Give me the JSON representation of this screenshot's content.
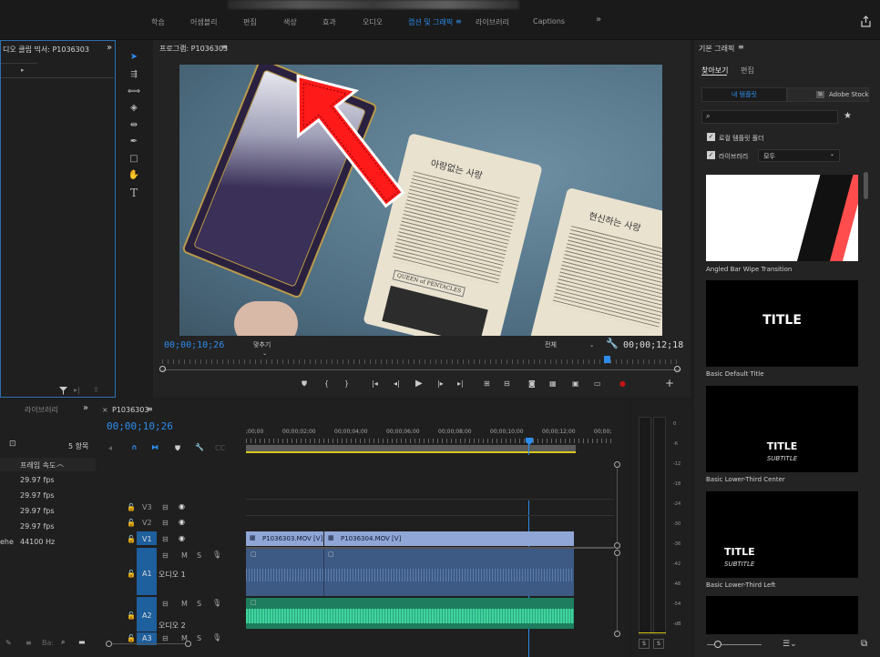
{
  "topbar": {
    "workspaces": [
      {
        "label": "학습",
        "active": false
      },
      {
        "label": "어셈블리",
        "active": false
      },
      {
        "label": "편집",
        "active": false
      },
      {
        "label": "색상",
        "active": false
      },
      {
        "label": "효과",
        "active": false
      },
      {
        "label": "오디오",
        "active": false
      },
      {
        "label": "캡션 및 그래픽",
        "active": true
      },
      {
        "label": "라이브러리",
        "active": false
      },
      {
        "label": "Captions",
        "active": false
      }
    ],
    "more": "»",
    "menu_icon": "≡"
  },
  "source_panel": {
    "title": "디오 클립 믹서: P1036303",
    "more": "»"
  },
  "program": {
    "title": "프로그램: P1036303",
    "menu": "≡",
    "timecode": "00;00;10;26",
    "fit": "맞추기",
    "quality": "전체",
    "duration": "00;00;12;18",
    "video": {
      "card1_title": "아랑없는 사랑",
      "card1_sub": "QUEEN of PENTACLES",
      "card2_title": "현신하는 사랑"
    }
  },
  "project_panel": {
    "tab": "라이브러리",
    "more": "»",
    "count": "5 항목",
    "col_framerate": "프레임 속도",
    "rows": [
      "29.97 fps",
      "29.97 fps",
      "29.97 fps",
      "29.97 fps",
      "44100 Hz"
    ],
    "row_prefix": "ehe"
  },
  "timeline": {
    "close": "×",
    "sequence": "P1036303",
    "menu": "≡",
    "timecode": "00;00;10;26",
    "ruler": [
      ";00;00",
      "00;00;02;00",
      "00;00;04;00",
      "00;00;06;00",
      "00;00;08;00",
      "00;00;10;00",
      "00;00;12;00",
      "00;00;"
    ],
    "tracks": {
      "v3": "V3",
      "v2": "V2",
      "v1": "V1",
      "a1": "A1",
      "a2": "A2",
      "a3": "A3",
      "a1_name": "오디오 1",
      "a2_name": "오디오 2",
      "mute": "M",
      "solo": "S"
    },
    "clips": {
      "v1a": "P1036303.MOV [V]",
      "v1b": "P1036304.MOV [V]"
    }
  },
  "meter": {
    "scale": [
      "0",
      "-6",
      "-12",
      "-18",
      "-24",
      "-30",
      "-36",
      "-42",
      "-48",
      "-54",
      "-dB"
    ],
    "solo1": "S",
    "solo2": "S"
  },
  "essential_graphics": {
    "title": "기본 그래픽",
    "menu": "≡",
    "tab_browse": "찾아보기",
    "tab_edit": "편집",
    "btn_my_templates": "내 템플릿",
    "btn_adobe_stock": "Adobe Stock",
    "stock_badge": "St",
    "search_placeholder": "",
    "local_folder": "로컬 템플릿 폴더",
    "libraries": "라이브러리",
    "libraries_select": "모두",
    "templates": [
      {
        "label": "Angled Bar Wipe Transition",
        "title": "",
        "subtitle": ""
      },
      {
        "label": "Basic Default Title",
        "title": "TITLE",
        "subtitle": ""
      },
      {
        "label": "Basic Lower-Third Center",
        "title": "TITLE",
        "subtitle": "SUBTITLE"
      },
      {
        "label": "Basic Lower-Third Left",
        "title": "TITLE",
        "subtitle": "SUBTITLE"
      }
    ]
  },
  "colors": {
    "accent": "#2d8ceb",
    "clip_video": "#8fa6d6",
    "clip_audio": "#2aa781",
    "arrow": "#ff1a1a"
  }
}
